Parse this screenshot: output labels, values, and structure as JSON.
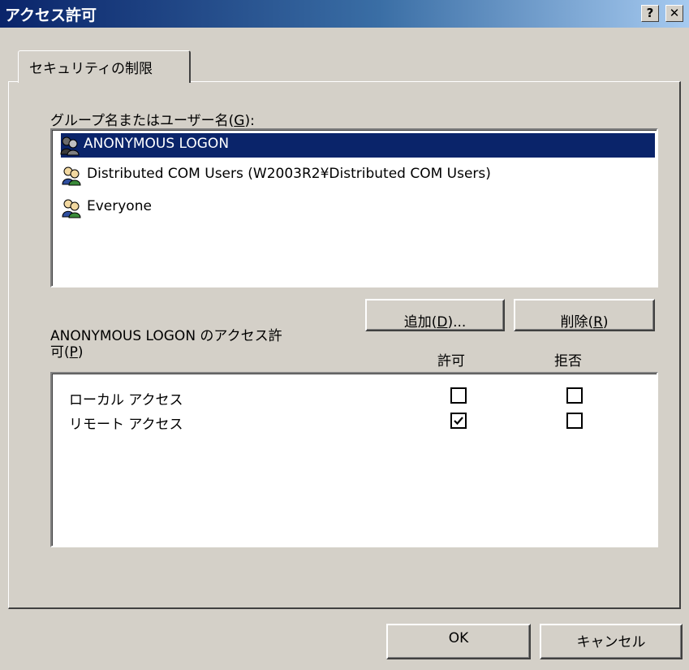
{
  "window": {
    "title": "アクセス許可",
    "help_glyph": "?",
    "close_glyph": "✕"
  },
  "tab": {
    "label": "セキュリティの制限"
  },
  "users": {
    "label_prefix": "グループ名またはユーザー名(",
    "label_key": "G",
    "label_suffix": "):",
    "items": [
      {
        "name": "ANONYMOUS LOGON",
        "icon": "user-group-icon",
        "selected": true
      },
      {
        "name": "Distributed COM Users (W2003R2¥Distributed COM Users)",
        "icon": "user-group-icon",
        "selected": false
      },
      {
        "name": "Everyone",
        "icon": "user-group-icon",
        "selected": false
      }
    ]
  },
  "buttons": {
    "add": {
      "prefix": "追加(",
      "key": "D",
      "suffix": ")..."
    },
    "remove": {
      "prefix": "削除(",
      "key": "R",
      "suffix": ")"
    },
    "ok": "OK",
    "cancel": "キャンセル"
  },
  "permissions": {
    "label_line1": "ANONYMOUS LOGON のアクセス許",
    "label_line2_prefix": "可(",
    "label_line2_key": "P",
    "label_line2_suffix": ")",
    "col_allow": "許可",
    "col_deny": "拒否",
    "rows": [
      {
        "name": "ローカル アクセス",
        "allow": false,
        "deny": false
      },
      {
        "name": "リモート アクセス",
        "allow": true,
        "deny": false
      }
    ]
  },
  "colors": {
    "selection": "#0a246a",
    "titlebar_start": "#0a246a",
    "titlebar_end": "#a6caf0",
    "face": "#d4d0c8"
  }
}
